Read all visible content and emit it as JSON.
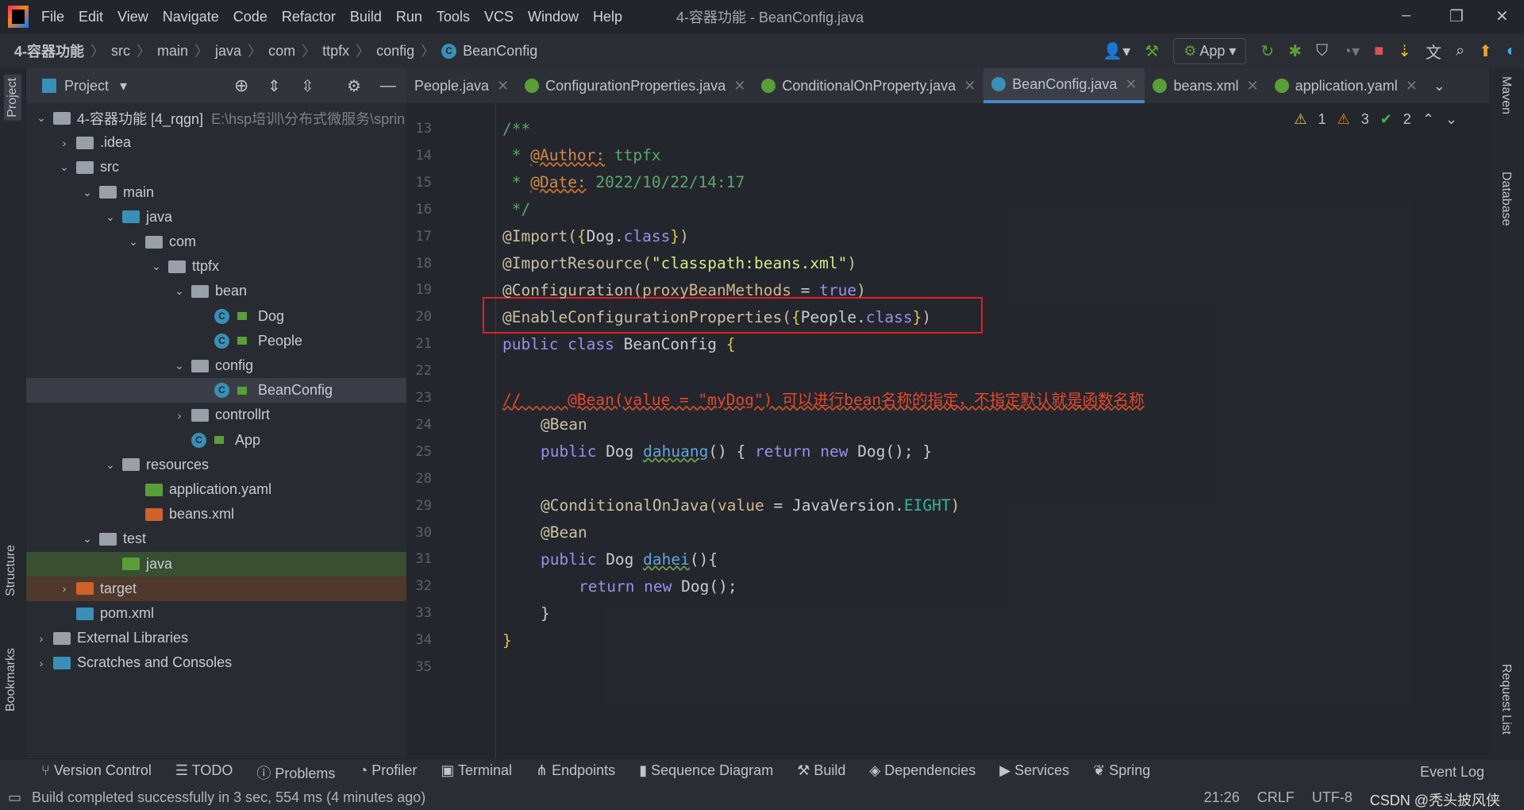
{
  "window": {
    "title": "4-容器功能 - BeanConfig.java",
    "menu": [
      "File",
      "Edit",
      "View",
      "Navigate",
      "Code",
      "Refactor",
      "Build",
      "Run",
      "Tools",
      "VCS",
      "Window",
      "Help"
    ]
  },
  "breadcrumb": [
    "4-容器功能",
    "src",
    "main",
    "java",
    "com",
    "ttpfx",
    "config",
    "BeanConfig"
  ],
  "toolbar": {
    "run_config": "App"
  },
  "left_strip": {
    "project": "Project",
    "structure": "Structure",
    "bookmarks": "Bookmarks"
  },
  "right_strip": {
    "maven": "Maven",
    "database": "Database",
    "request": "Request List"
  },
  "project_panel": {
    "title": "Project"
  },
  "tree": [
    {
      "label": "4-容器功能 [4_rqgn]",
      "extra": "E:\\hsp培训\\分布式微服务\\sprin",
      "depth": 0,
      "arrow": "v",
      "icon": "module"
    },
    {
      "label": ".idea",
      "depth": 1,
      "arrow": ">",
      "icon": "folder"
    },
    {
      "label": "src",
      "depth": 1,
      "arrow": "v",
      "icon": "folder"
    },
    {
      "label": "main",
      "depth": 2,
      "arrow": "v",
      "icon": "folder"
    },
    {
      "label": "java",
      "depth": 3,
      "arrow": "v",
      "icon": "folder-blue"
    },
    {
      "label": "com",
      "depth": 4,
      "arrow": "v",
      "icon": "package"
    },
    {
      "label": "ttpfx",
      "depth": 5,
      "arrow": "v",
      "icon": "package"
    },
    {
      "label": "bean",
      "depth": 6,
      "arrow": "v",
      "icon": "package"
    },
    {
      "label": "Dog",
      "depth": 7,
      "arrow": "",
      "icon": "class"
    },
    {
      "label": "People",
      "depth": 7,
      "arrow": "",
      "icon": "class"
    },
    {
      "label": "config",
      "depth": 6,
      "arrow": "v",
      "icon": "package"
    },
    {
      "label": "BeanConfig",
      "depth": 7,
      "arrow": "",
      "icon": "class",
      "state": "sel"
    },
    {
      "label": "controllrt",
      "depth": 6,
      "arrow": ">",
      "icon": "package"
    },
    {
      "label": "App",
      "depth": 6,
      "arrow": "",
      "icon": "spring-app"
    },
    {
      "label": "resources",
      "depth": 3,
      "arrow": "v",
      "icon": "folder"
    },
    {
      "label": "application.yaml",
      "depth": 4,
      "arrow": "",
      "icon": "yaml"
    },
    {
      "label": "beans.xml",
      "depth": 4,
      "arrow": "",
      "icon": "xml"
    },
    {
      "label": "test",
      "depth": 2,
      "arrow": "v",
      "icon": "folder"
    },
    {
      "label": "java",
      "depth": 3,
      "arrow": "",
      "icon": "folder-green",
      "state": "green"
    },
    {
      "label": "target",
      "depth": 1,
      "arrow": ">",
      "icon": "folder-orange",
      "state": "orange"
    },
    {
      "label": "pom.xml",
      "depth": 1,
      "arrow": "",
      "icon": "maven"
    },
    {
      "label": "External Libraries",
      "depth": 0,
      "arrow": ">",
      "icon": "libraries"
    },
    {
      "label": "Scratches and Consoles",
      "depth": 0,
      "arrow": ">",
      "icon": "scratches"
    }
  ],
  "tabs": [
    {
      "label": "People.java",
      "active": false
    },
    {
      "label": "ConfigurationProperties.java",
      "active": false
    },
    {
      "label": "ConditionalOnProperty.java",
      "active": false
    },
    {
      "label": "BeanConfig.java",
      "active": true
    },
    {
      "label": "beans.xml",
      "active": false
    },
    {
      "label": "application.yaml",
      "active": false
    }
  ],
  "inspections": {
    "weak_warnings": "1",
    "warnings": "3",
    "typos": "2"
  },
  "code": [
    {
      "n": "13",
      "indent": 0,
      "tokens": [
        [
          "comment",
          "/**"
        ]
      ]
    },
    {
      "n": "14",
      "indent": 0,
      "tokens": [
        [
          "comment",
          " * "
        ],
        [
          "doctag",
          "@Author:"
        ],
        [
          "comment",
          " ttpfx"
        ]
      ]
    },
    {
      "n": "15",
      "indent": 0,
      "tokens": [
        [
          "comment",
          " * "
        ],
        [
          "doctag",
          "@Date:"
        ],
        [
          "comment",
          " 2022/10/22/14:17"
        ]
      ]
    },
    {
      "n": "16",
      "indent": 0,
      "tokens": [
        [
          "comment",
          " */"
        ]
      ]
    },
    {
      "n": "17",
      "indent": 0,
      "tokens": [
        [
          "ann",
          "@Import("
        ],
        [
          "brace",
          "{"
        ],
        [
          "plain",
          "Dog."
        ],
        [
          "kw",
          "class"
        ],
        [
          "brace",
          "}"
        ],
        [
          "ann",
          ")"
        ]
      ]
    },
    {
      "n": "18",
      "indent": 0,
      "tokens": [
        [
          "ann",
          "@ImportResource("
        ],
        [
          "str",
          "\"classpath:beans.xml\""
        ],
        [
          "ann",
          ")"
        ]
      ]
    },
    {
      "n": "19",
      "indent": 0,
      "tokens": [
        [
          "ann",
          "@Configuration("
        ],
        [
          "param",
          "proxyBeanMethods"
        ],
        [
          "plain",
          " = "
        ],
        [
          "kw",
          "true"
        ],
        [
          "ann",
          ")"
        ]
      ]
    },
    {
      "n": "20",
      "indent": 0,
      "tokens": [
        [
          "ann",
          "@EnableConfigurationProperties("
        ],
        [
          "brace",
          "{"
        ],
        [
          "plain",
          "People."
        ],
        [
          "kw",
          "class"
        ],
        [
          "brace",
          "}"
        ],
        [
          "ann",
          ")"
        ]
      ]
    },
    {
      "n": "21",
      "indent": 0,
      "tokens": [
        [
          "kw",
          "public class "
        ],
        [
          "plain",
          "BeanConfig "
        ],
        [
          "brace",
          "{"
        ]
      ]
    },
    {
      "n": "22",
      "indent": 0,
      "tokens": []
    },
    {
      "n": "23",
      "indent": 0,
      "tokens": [
        [
          "red",
          "//     @Bean(value = \"myDog\") 可以进行bean名称的指定，不指定默认就是函数名称"
        ]
      ]
    },
    {
      "n": "24",
      "indent": 1,
      "tokens": [
        [
          "ann",
          "@Bean"
        ]
      ]
    },
    {
      "n": "25",
      "indent": 1,
      "tokens": [
        [
          "kw",
          "public "
        ],
        [
          "plain",
          "Dog "
        ],
        [
          "fn",
          "dahuang"
        ],
        [
          "plain",
          "() { "
        ],
        [
          "kw",
          "return new "
        ],
        [
          "plain",
          "Dog(); }"
        ]
      ]
    },
    {
      "n": "28",
      "indent": 0,
      "tokens": []
    },
    {
      "n": "29",
      "indent": 1,
      "tokens": [
        [
          "ann",
          "@ConditionalOnJava("
        ],
        [
          "param",
          "value"
        ],
        [
          "plain",
          " = JavaVersion."
        ],
        [
          "const",
          "EIGHT"
        ],
        [
          "ann",
          ")"
        ]
      ]
    },
    {
      "n": "30",
      "indent": 1,
      "tokens": [
        [
          "ann",
          "@Bean"
        ]
      ]
    },
    {
      "n": "31",
      "indent": 1,
      "tokens": [
        [
          "kw",
          "public "
        ],
        [
          "plain",
          "Dog "
        ],
        [
          "fn",
          "dahei"
        ],
        [
          "plain",
          "(){"
        ]
      ]
    },
    {
      "n": "32",
      "indent": 2,
      "tokens": [
        [
          "kw",
          "return new "
        ],
        [
          "plain",
          "Dog();"
        ]
      ]
    },
    {
      "n": "33",
      "indent": 1,
      "tokens": [
        [
          "plain",
          "}"
        ]
      ]
    },
    {
      "n": "34",
      "indent": 0,
      "tokens": [
        [
          "brace",
          "}"
        ]
      ]
    },
    {
      "n": "35",
      "indent": 0,
      "tokens": []
    }
  ],
  "bottom_tools": [
    "Version Control",
    "TODO",
    "Problems",
    "Profiler",
    "Terminal",
    "Endpoints",
    "Sequence Diagram",
    "Build",
    "Dependencies",
    "Services",
    "Spring"
  ],
  "event_log": "Event Log",
  "status": {
    "message": "Build completed successfully in 3 sec, 554 ms (4 minutes ago)",
    "position": "21:26",
    "line_sep": "CRLF",
    "encoding": "UTF-8",
    "watermark": "CSDN @秃头披风侠"
  },
  "colors": {
    "accent": "#4a88c7",
    "highlight_box": "#e02020"
  }
}
